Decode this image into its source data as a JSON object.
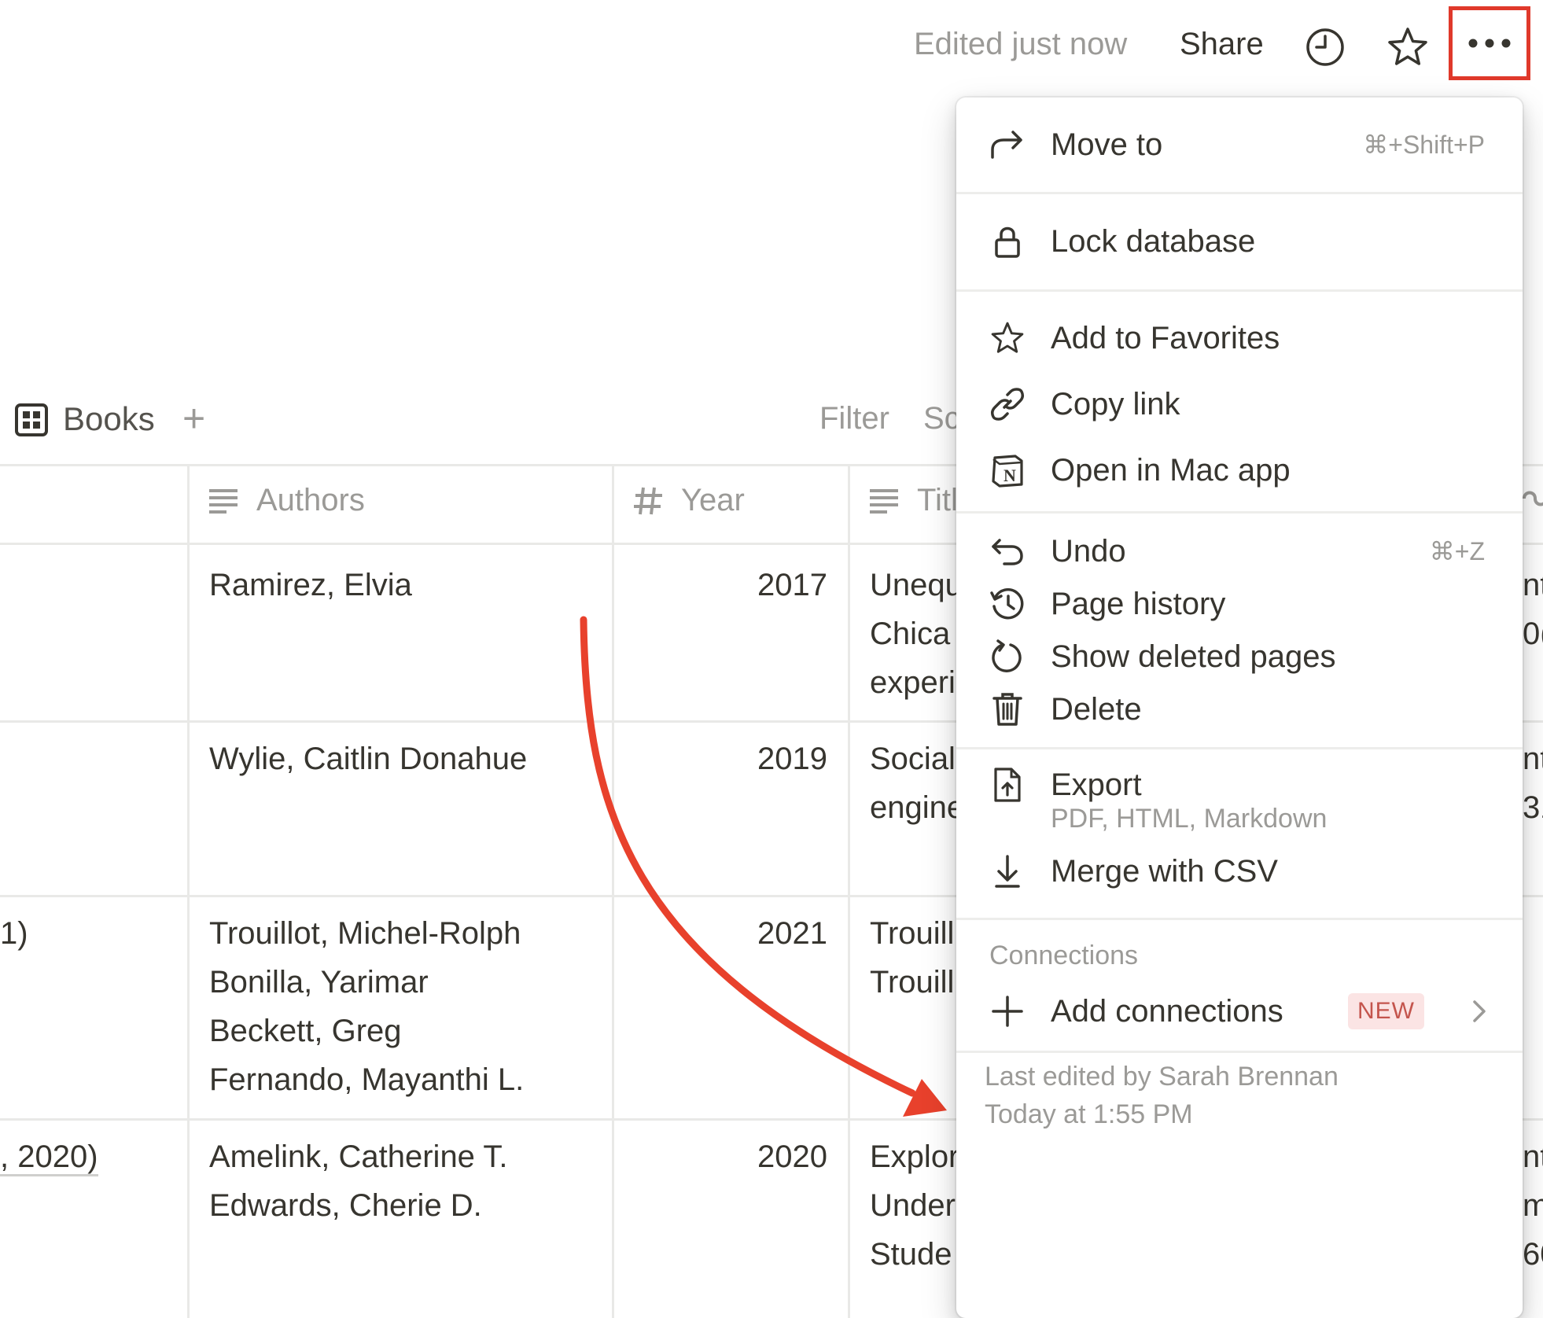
{
  "topbar": {
    "edited": "Edited just now",
    "share": "Share"
  },
  "view": {
    "name": "Books",
    "add": "+",
    "filter": "Filter",
    "sort": "Sc"
  },
  "table": {
    "columns": [
      "Authors",
      "Year",
      "Titl"
    ],
    "rows": [
      {
        "c0": "",
        "authors": [
          "Ramirez, Elvia"
        ],
        "year": "2017",
        "title": [
          "Unequ",
          "Chica",
          "experi"
        ],
        "right": [
          "nt",
          "0("
        ]
      },
      {
        "c0": "",
        "authors": [
          "Wylie, Caitlin Donahue"
        ],
        "year": "2019",
        "title": [
          "Social",
          "engine"
        ],
        "right": [
          "nt",
          "31"
        ]
      },
      {
        "c0": "1)",
        "authors": [
          "Trouillot, Michel-Rolph",
          "Bonilla, Yarimar",
          "Beckett, Greg",
          "Fernando, Mayanthi L."
        ],
        "year": "2021",
        "title": [
          "Trouill",
          "Trouill"
        ],
        "right": []
      },
      {
        "c0": ", 2020)",
        "authors": [
          "Amelink, Catherine T.",
          "Edwards, Cherie D."
        ],
        "year": "2020",
        "title": [
          "Explor",
          "Under",
          "Stude"
        ],
        "right": [
          "nt",
          "m",
          "60"
        ]
      }
    ]
  },
  "menu": {
    "move_to": {
      "label": "Move to",
      "shortcut": "⌘+Shift+P"
    },
    "lock": {
      "label": "Lock database"
    },
    "favorites": {
      "label": "Add to Favorites"
    },
    "copy_link": {
      "label": "Copy link"
    },
    "open_mac": {
      "label": "Open in Mac app"
    },
    "undo": {
      "label": "Undo",
      "shortcut": "⌘+Z"
    },
    "page_history": {
      "label": "Page history"
    },
    "show_deleted": {
      "label": "Show deleted pages"
    },
    "delete": {
      "label": "Delete"
    },
    "export": {
      "label": "Export",
      "sub": "PDF, HTML, Markdown"
    },
    "merge_csv": {
      "label": "Merge with CSV"
    },
    "connections_header": "Connections",
    "add_connections": {
      "label": "Add connections",
      "badge": "NEW"
    },
    "footer": {
      "line1": "Last edited by Sarah Brennan",
      "line2": "Today at 1:55 PM"
    }
  },
  "colors": {
    "highlight": "#e0392b",
    "arrow": "#e8412c",
    "badge_bg": "#fbe4e4",
    "badge_text": "#c4554d"
  }
}
